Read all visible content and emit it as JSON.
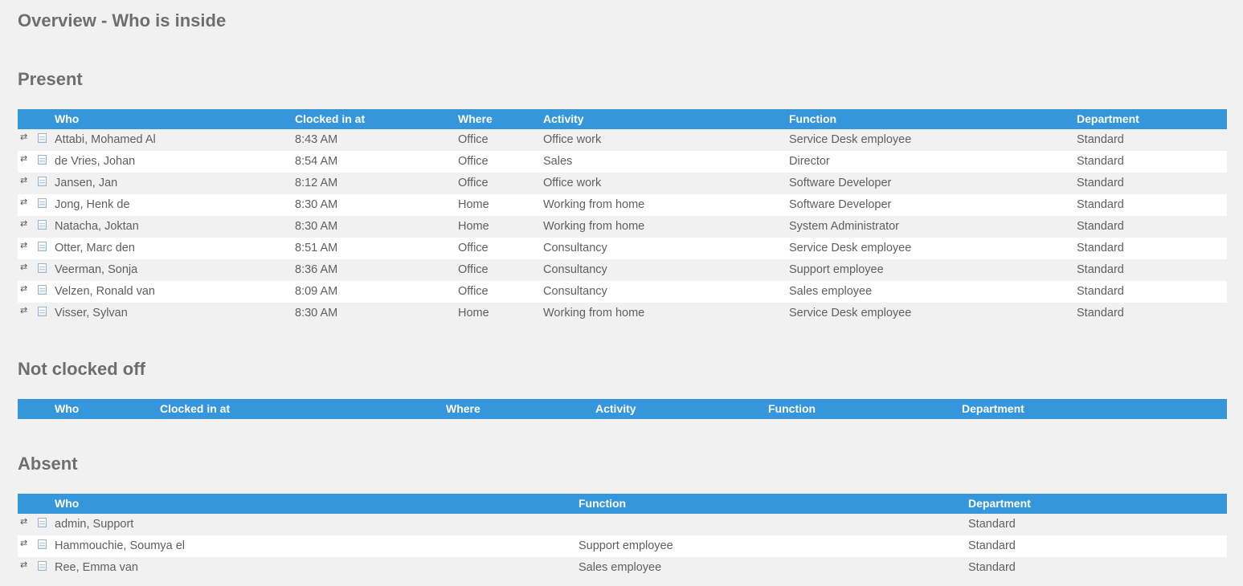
{
  "page_title": "Overview - Who is inside",
  "present": {
    "title": "Present",
    "headers": {
      "who": "Who",
      "clocked_in_at": "Clocked in at",
      "where": "Where",
      "activity": "Activity",
      "function": "Function",
      "department": "Department"
    },
    "rows": [
      {
        "who": "Attabi, Mohamed Al",
        "clocked_in_at": "8:43 AM",
        "where": "Office",
        "activity": "Office work",
        "function": "Service Desk employee",
        "department": "Standard"
      },
      {
        "who": "de Vries, Johan",
        "clocked_in_at": "8:54 AM",
        "where": "Office",
        "activity": "Sales",
        "function": "Director",
        "department": "Standard"
      },
      {
        "who": "Jansen, Jan",
        "clocked_in_at": "8:12 AM",
        "where": "Office",
        "activity": "Office work",
        "function": "Software Developer",
        "department": "Standard"
      },
      {
        "who": "Jong, Henk de",
        "clocked_in_at": "8:30 AM",
        "where": "Home",
        "activity": "Working from home",
        "function": "Software Developer",
        "department": "Standard"
      },
      {
        "who": "Natacha, Joktan",
        "clocked_in_at": "8:30 AM",
        "where": "Home",
        "activity": "Working from home",
        "function": "System Administrator",
        "department": "Standard"
      },
      {
        "who": "Otter, Marc den",
        "clocked_in_at": "8:51 AM",
        "where": "Office",
        "activity": "Consultancy",
        "function": "Service Desk employee",
        "department": "Standard"
      },
      {
        "who": "Veerman, Sonja",
        "clocked_in_at": "8:36 AM",
        "where": "Office",
        "activity": "Consultancy",
        "function": "Support employee",
        "department": "Standard"
      },
      {
        "who": "Velzen, Ronald van",
        "clocked_in_at": "8:09 AM",
        "where": "Office",
        "activity": "Consultancy",
        "function": "Sales employee",
        "department": "Standard"
      },
      {
        "who": "Visser, Sylvan",
        "clocked_in_at": "8:30 AM",
        "where": "Home",
        "activity": "Working from home",
        "function": "Service Desk employee",
        "department": "Standard"
      }
    ]
  },
  "not_clocked_off": {
    "title": "Not clocked off",
    "headers": {
      "who": "Who",
      "clocked_in_at": "Clocked in at",
      "where": "Where",
      "activity": "Activity",
      "function": "Function",
      "department": "Department"
    },
    "rows": []
  },
  "absent": {
    "title": "Absent",
    "headers": {
      "who": "Who",
      "function": "Function",
      "department": "Department"
    },
    "rows": [
      {
        "who": "admin, Support",
        "function": "",
        "department": "Standard"
      },
      {
        "who": "Hammouchie, Soumya el",
        "function": "Support employee",
        "department": "Standard"
      },
      {
        "who": "Ree, Emma van",
        "function": "Sales employee",
        "department": "Standard"
      }
    ]
  },
  "icons": {
    "row_swap": "swap-arrows-icon",
    "row_details": "document-icon"
  },
  "colors": {
    "header_bg": "#3596dc",
    "header_text": "#ffffff",
    "page_bg": "#f1f1f1",
    "alt_row_bg": "#ffffff",
    "text": "#5f5f5f"
  }
}
